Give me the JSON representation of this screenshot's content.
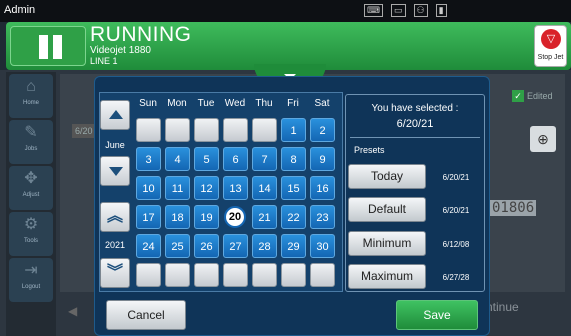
{
  "system_bar": {
    "user": "Admin"
  },
  "header": {
    "state": "RUNNING",
    "printer": "Videojet 1880",
    "line": "LINE 1",
    "stop_label": "Stop Jet"
  },
  "sidebar": {
    "items": [
      {
        "label": "Home",
        "icon": "home-icon"
      },
      {
        "label": "Jobs",
        "icon": "jobs-icon"
      },
      {
        "label": "Adjust",
        "icon": "adjust-icon"
      },
      {
        "label": "Tools",
        "icon": "tools-icon"
      },
      {
        "label": "Logout",
        "icon": "logout-icon"
      }
    ]
  },
  "background": {
    "edited_label": "Edited",
    "field_value": "6/20",
    "code_fragment": "01806",
    "continue_label": "ntinue"
  },
  "calendar": {
    "month": "June",
    "year": "2021",
    "weekdays": [
      "Sun",
      "Mon",
      "Tue",
      "Wed",
      "Thu",
      "Fri",
      "Sat"
    ],
    "weeks": [
      [
        "",
        "",
        "",
        "",
        "",
        "1",
        "2"
      ],
      [
        "3",
        "4",
        "5",
        "6",
        "7",
        "8",
        "9"
      ],
      [
        "10",
        "11",
        "12",
        "13",
        "14",
        "15",
        "16"
      ],
      [
        "17",
        "18",
        "19",
        "20",
        "21",
        "22",
        "23"
      ],
      [
        "24",
        "25",
        "26",
        "27",
        "28",
        "29",
        "30"
      ],
      [
        "",
        "",
        "",
        "",
        "",
        "",
        ""
      ]
    ],
    "selected_day": "20"
  },
  "selection": {
    "title": "You have selected :",
    "date": "6/20/21"
  },
  "presets": {
    "label": "Presets",
    "items": [
      {
        "label": "Today",
        "date": "6/20/21"
      },
      {
        "label": "Default",
        "date": "6/20/21"
      },
      {
        "label": "Minimum",
        "date": "6/12/08"
      },
      {
        "label": "Maximum",
        "date": "6/27/28"
      }
    ]
  },
  "buttons": {
    "cancel": "Cancel",
    "save": "Save"
  },
  "colors": {
    "running_green": "#2fa047",
    "modal_bg": "#0f3458",
    "day_blue": "#1a7ccc",
    "stop_red": "#d9222a"
  }
}
